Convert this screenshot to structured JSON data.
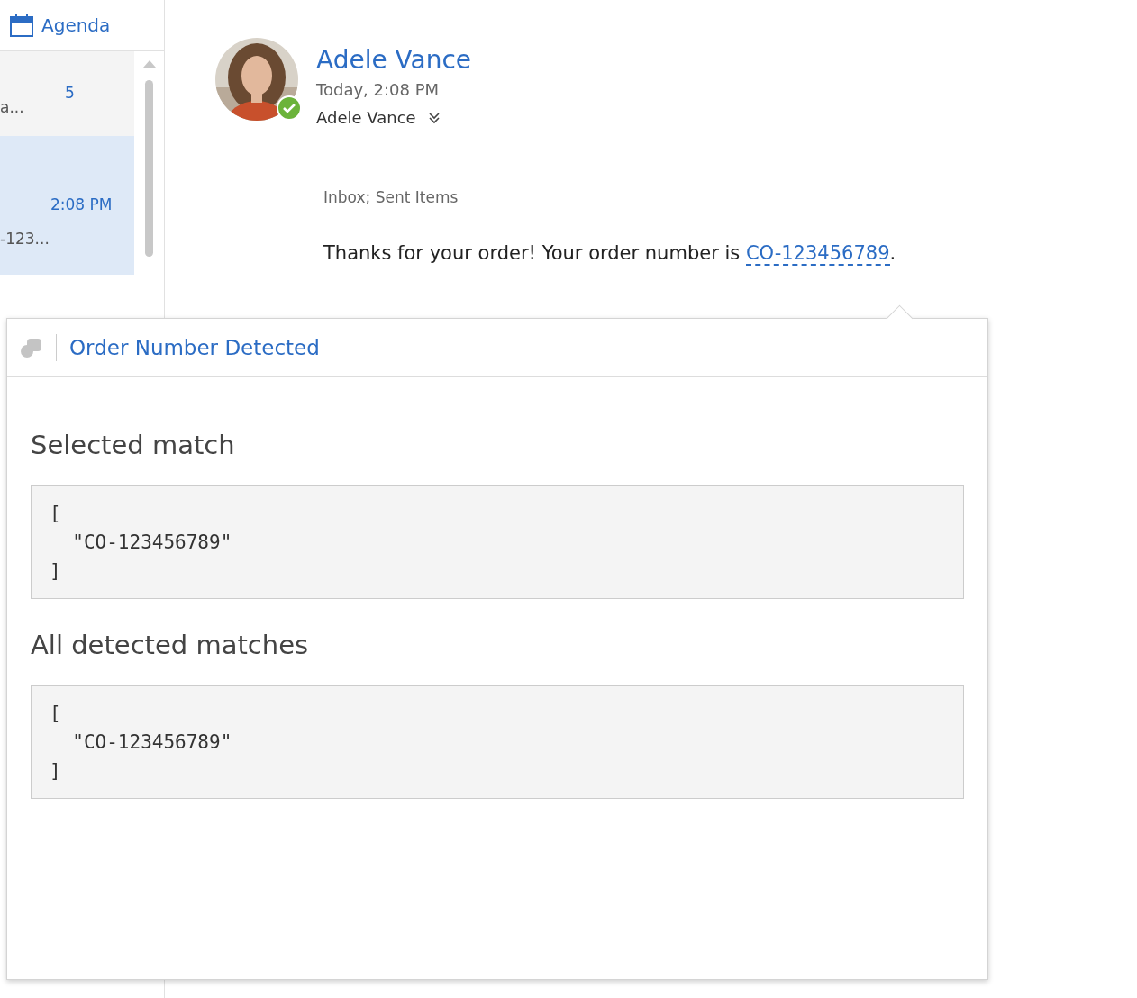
{
  "sidebar": {
    "agenda_label": "Agenda",
    "items": [
      {
        "subject": "a...",
        "count": "5",
        "selected": false
      },
      {
        "time": "2:08 PM",
        "preview": "-123...",
        "selected": true
      }
    ]
  },
  "message": {
    "sender": "Adele Vance",
    "date": "Today, 2:08 PM",
    "recipient": "Adele Vance",
    "folders": "Inbox; Sent Items",
    "body_before": "Thanks for your order! Your order number is ",
    "link": "CO-123456789",
    "body_after": "."
  },
  "addin": {
    "title": "Order Number Detected",
    "sections": [
      {
        "heading": "Selected match",
        "code": "[\n  \"CO-123456789\"\n]"
      },
      {
        "heading": "All detected matches",
        "code": "[\n  \"CO-123456789\"\n]"
      }
    ]
  }
}
